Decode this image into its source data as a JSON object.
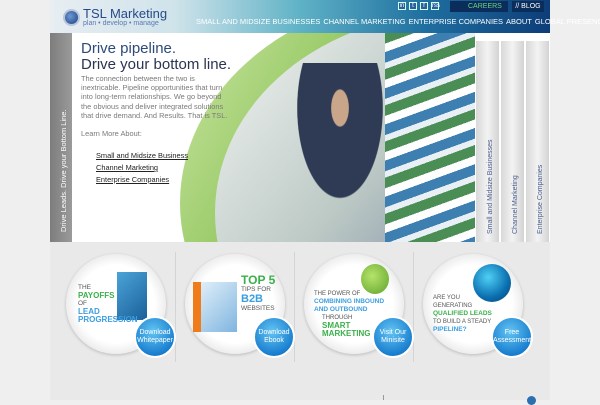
{
  "header": {
    "logo_title": "TSL Marketing",
    "logo_tagline": "plan • develop • manage",
    "nav": [
      "SMALL AND MIDSIZE BUSINESSES",
      "CHANNEL MARKETING",
      "ENTERPRISE COMPANIES",
      "ABOUT",
      "GLOBAL PRESENCE"
    ],
    "social": [
      "in",
      "t",
      "f",
      "rss"
    ],
    "careers": "CAREERS",
    "blog": "// BLOG"
  },
  "hero": {
    "side_text": "Drive Leads. Drive your Bottom Line.",
    "headline1": "Drive pipeline.",
    "headline2": "Drive your bottom line.",
    "paragraph": "The connection between the two is inextricable. Pipeline opportunities that turn into long-term relationships. We go beyond the obvious and deliver integrated solutions that drive demand. And Results. That is TSL.",
    "learn_more": "Learn More About:",
    "links": [
      "Small and Midsize Business",
      "Channel Marketing",
      "Enterprise Companies"
    ],
    "tabs": [
      "Small and Midsize Businesses",
      "Channel Marketing",
      "Enterprise Companies"
    ]
  },
  "cards": [
    {
      "lines": [
        "THE",
        "PAYOFFS",
        "OF",
        "LEAD",
        "PROGRESSION"
      ],
      "button": "Download Whitepaper"
    },
    {
      "lines": [
        "TOP 5",
        "TIPS FOR",
        "B2B",
        "WEBSITES"
      ],
      "button": "Download Ebook"
    },
    {
      "lines": [
        "THE POWER OF",
        "COMBINING INBOUND AND OUTBOUND",
        "THROUGH",
        "SMART MARKETING"
      ],
      "button": "Visit Our Minisite"
    },
    {
      "lines": [
        "ARE YOU GENERATING",
        "QUALIFIED LEADS",
        "TO BUILD A STEADY",
        "PIPELINE?"
      ],
      "button": "Free Assessment"
    }
  ]
}
